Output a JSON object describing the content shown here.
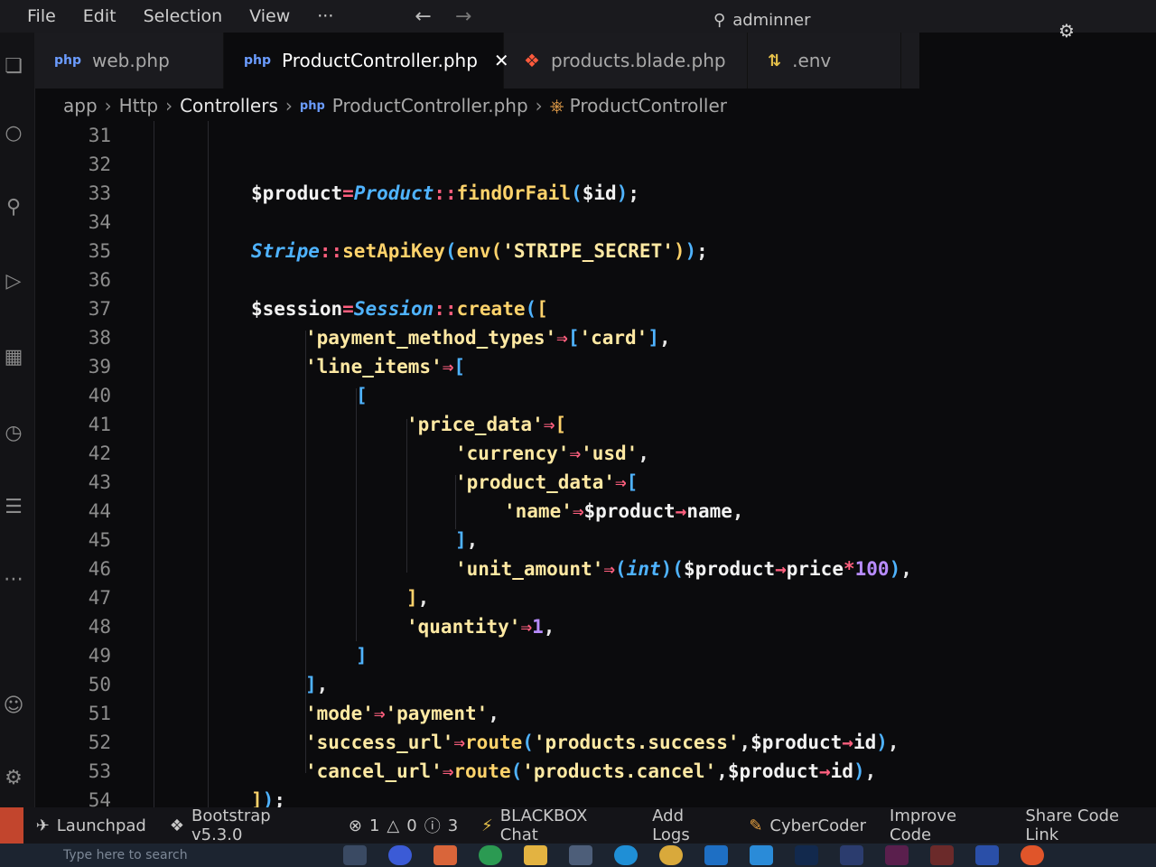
{
  "menu": {
    "items": [
      "File",
      "Edit",
      "Selection",
      "View",
      "···"
    ]
  },
  "nav": {
    "back": "←",
    "forward": "→"
  },
  "command_center": {
    "label": "adminner"
  },
  "tabs": [
    {
      "label": "web.php",
      "icon": "php-icon",
      "active": false
    },
    {
      "label": "ProductController.php",
      "icon": "php-icon",
      "active": true
    },
    {
      "label": "products.blade.php",
      "icon": "blade-icon",
      "active": false
    },
    {
      "label": ".env",
      "icon": "env-icon",
      "active": false
    }
  ],
  "breadcrumb": [
    "app",
    "Http",
    "Controllers",
    "ProductController.php",
    "ProductController"
  ],
  "editor": {
    "line_numbers": [
      "31",
      "32",
      "33",
      "34",
      "35",
      "36",
      "37",
      "38",
      "39",
      "40",
      "41",
      "42",
      "43",
      "44",
      "45",
      "46",
      "47",
      "48",
      "49",
      "50",
      "51",
      "52",
      "53",
      "54"
    ]
  },
  "status_bar": {
    "launchpad": "Launchpad",
    "bootstrap": "Bootstrap v5.3.0",
    "errors": "1",
    "warnings": "0",
    "info": "3",
    "blackbox": "BLACKBOX Chat",
    "add_logs": "Add Logs",
    "cybercoder": "CyberCoder",
    "improve_code": "Improve Code",
    "share_code": "Share Code Link"
  },
  "taskbar": {
    "search_placeholder": "Type here to search"
  },
  "colors": {
    "background": "#0b0b0d",
    "variable": "#f2f2f2",
    "class": "#4fb3ff",
    "function": "#ffd36b",
    "string": "#ffe9a3",
    "operator": "#ff5f7e",
    "number": "#b88cff"
  }
}
